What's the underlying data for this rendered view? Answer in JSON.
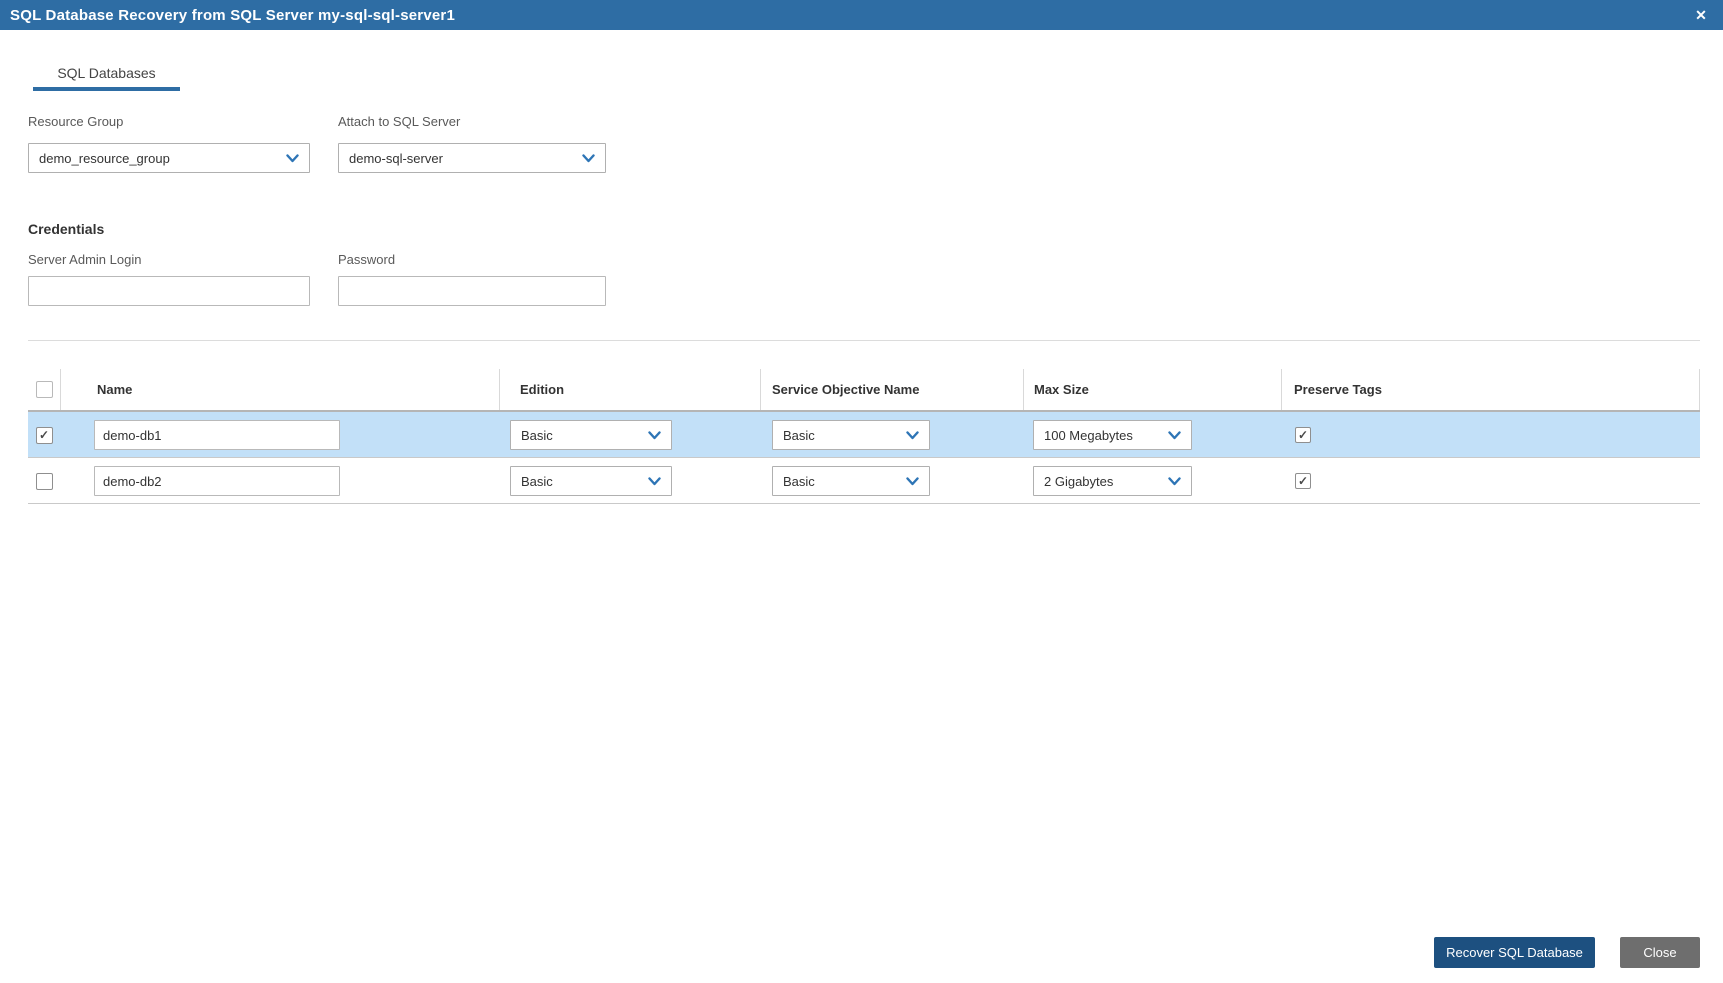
{
  "title_bar": {
    "title": "SQL Database Recovery from SQL Server my-sql-sql-server1"
  },
  "icons": {
    "close": "✕"
  },
  "tabs": [
    {
      "label": "SQL Databases",
      "active": true
    }
  ],
  "form": {
    "resource_group": {
      "label": "Resource Group",
      "value": "demo_resource_group"
    },
    "attach_to_sql_server": {
      "label": "Attach to SQL Server",
      "value": "demo-sql-server"
    },
    "credentials": {
      "heading": "Credentials",
      "server_admin_login": {
        "label": "Server Admin Login",
        "value": ""
      },
      "password": {
        "label": "Password",
        "value": ""
      }
    }
  },
  "table": {
    "columns": [
      "Name",
      "Edition",
      "Service Objective Name",
      "Max Size",
      "Preserve Tags"
    ],
    "select_all_checked": false,
    "rows": [
      {
        "selected": true,
        "highlighted": true,
        "name": "demo-db1",
        "edition": "Basic",
        "service_objective_name": "Basic",
        "max_size": "100 Megabytes",
        "preserve_tags": true
      },
      {
        "selected": false,
        "highlighted": false,
        "name": "demo-db2",
        "edition": "Basic",
        "service_objective_name": "Basic",
        "max_size": "2 Gigabytes",
        "preserve_tags": true
      }
    ]
  },
  "footer": {
    "recover_label": "Recover SQL Database",
    "close_label": "Close"
  },
  "colors": {
    "title_bar": "#2e6da4",
    "accent": "#2e6da4",
    "row_highlight": "#c2e0f8",
    "primary_button": "#1d5080",
    "secondary_button": "#6e6e6e",
    "chevron": "#2e75b6"
  }
}
